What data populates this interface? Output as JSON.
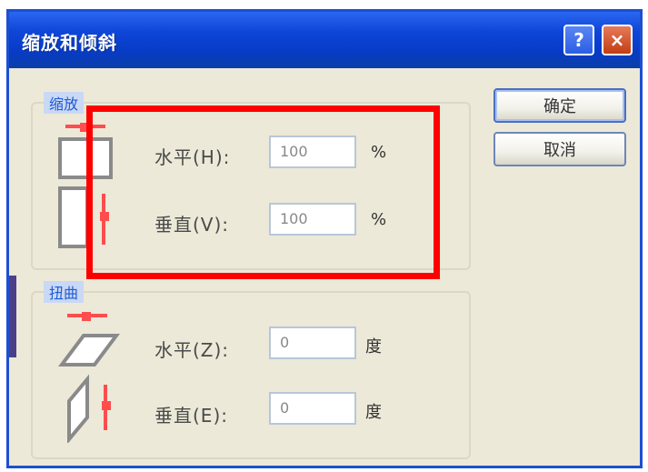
{
  "window": {
    "title": "缩放和倾斜",
    "help_button": "?",
    "close_button": "×"
  },
  "scale_group": {
    "legend": "缩放",
    "rows": [
      {
        "label": "水平(H):",
        "value": "100",
        "unit": "%"
      },
      {
        "label": "垂直(V):",
        "value": "100",
        "unit": "%"
      }
    ]
  },
  "skew_group": {
    "legend": "扭曲",
    "rows": [
      {
        "label": "水平(Z):",
        "value": "0",
        "unit": "度"
      },
      {
        "label": "垂直(E):",
        "value": "0",
        "unit": "度"
      }
    ]
  },
  "buttons": {
    "ok": "确定",
    "cancel": "取消"
  },
  "colors": {
    "highlight": "#ff0000",
    "titlebar": "#0e46d8",
    "dialog_bg": "#ece9d8"
  }
}
